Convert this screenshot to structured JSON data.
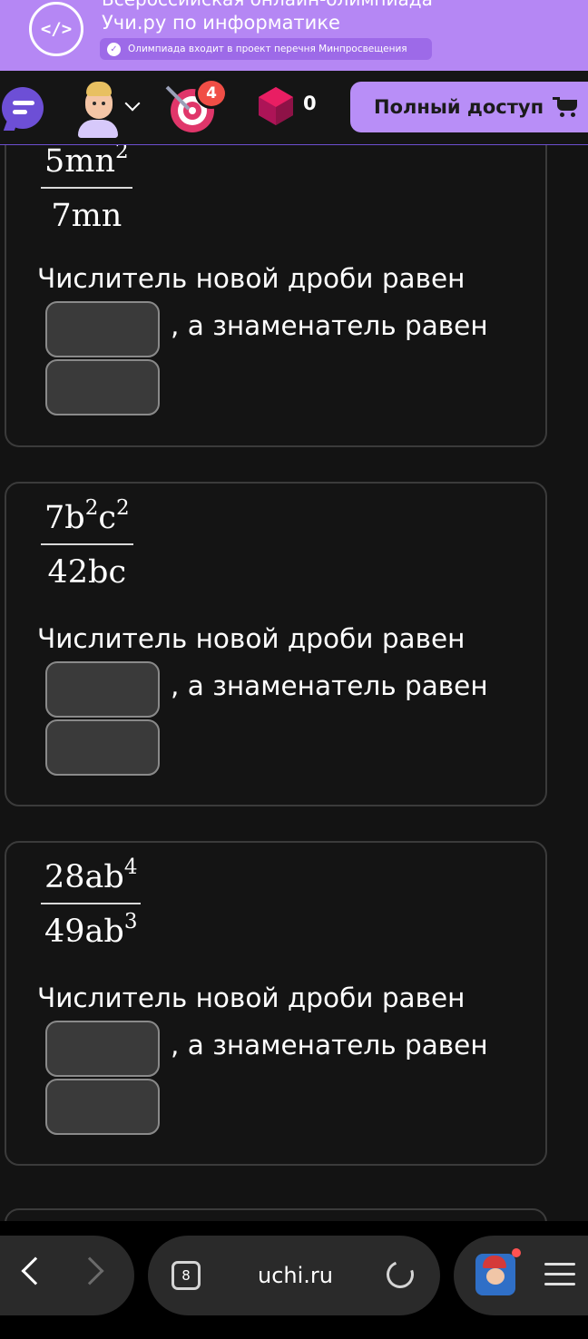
{
  "banner": {
    "logo_text": "</>",
    "title_cut": "Всероссийская онлайн-олимпиада",
    "title": "Учи.ру по информатике",
    "badge_text": "Олимпиада входит в проект перечня Минпросвещения"
  },
  "toolbar": {
    "target_count": "4",
    "gems_count": "0",
    "full_access_label": "Полный доступ"
  },
  "questions": [
    {
      "numerator": {
        "base": "5mn",
        "exp": "2"
      },
      "denominator": {
        "base": "7mn",
        "exp": ""
      },
      "prompt_line1": "Числитель новой дроби равен",
      "prompt_line2": ", а знаменатель равен",
      "numerator_answer": "",
      "denominator_answer": ""
    },
    {
      "numerator": {
        "parts": [
          "7b",
          "2",
          "c",
          "2"
        ]
      },
      "denominator": {
        "base": "42bc",
        "exp": ""
      },
      "prompt_line1": "Числитель новой дроби равен",
      "prompt_line2": ", а знаменатель равен",
      "numerator_answer": "",
      "denominator_answer": ""
    },
    {
      "numerator": {
        "base": "28ab",
        "exp": "4"
      },
      "denominator": {
        "base": "49ab",
        "exp": "3"
      },
      "prompt_line1": "Числитель новой дроби равен",
      "prompt_line2": ", а знаменатель равен",
      "numerator_answer": "",
      "denominator_answer": ""
    }
  ],
  "browser": {
    "tabs_count": "8",
    "url": "uchi.ru"
  }
}
